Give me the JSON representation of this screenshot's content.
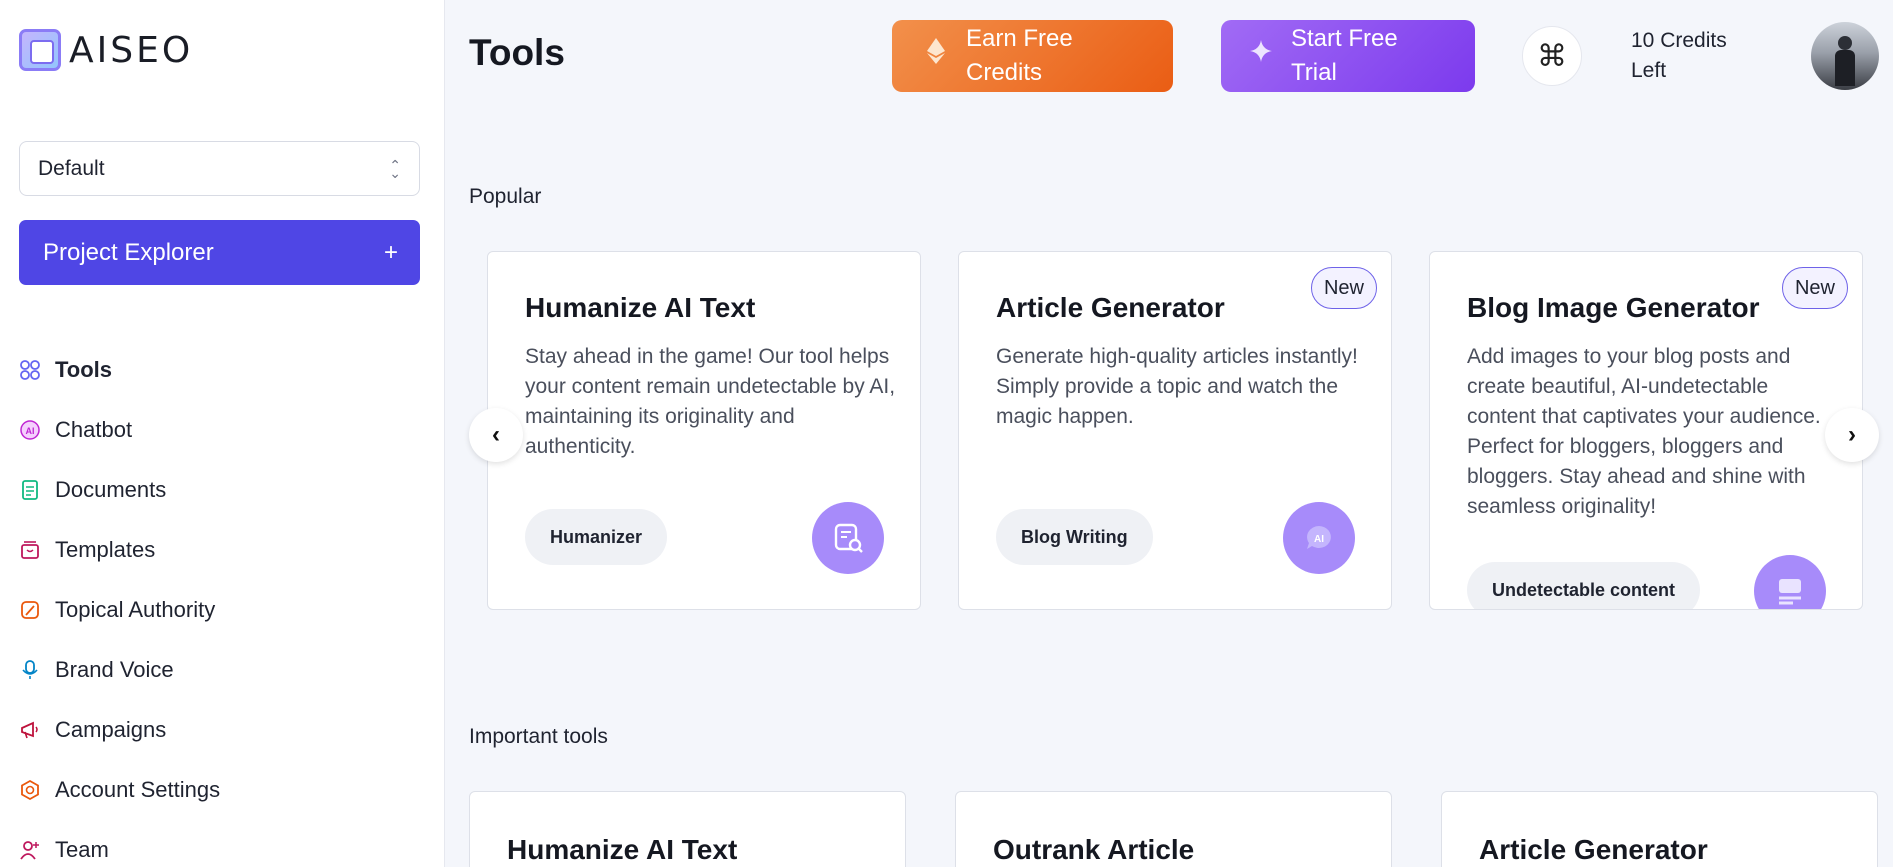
{
  "logo": {
    "text": "AISEO"
  },
  "sidebar": {
    "project_select": {
      "value": "Default"
    },
    "project_explorer": {
      "label": "Project Explorer",
      "plus": "+"
    },
    "items": [
      {
        "label": "Tools",
        "icon": "grid-icon",
        "color": "#6366f1",
        "glyph": "⊞",
        "active": true
      },
      {
        "label": "Chatbot",
        "icon": "ai-chat-icon",
        "color": "#c026d3",
        "glyph": "Ⓐ"
      },
      {
        "label": "Documents",
        "icon": "document-icon",
        "color": "#10b981",
        "glyph": "▤"
      },
      {
        "label": "Templates",
        "icon": "template-icon",
        "color": "#be185d",
        "glyph": "▭"
      },
      {
        "label": "Topical Authority",
        "icon": "feather-icon",
        "color": "#ea580c",
        "glyph": "✎"
      },
      {
        "label": "Brand Voice",
        "icon": "microphone-icon",
        "color": "#0284c7",
        "glyph": "♫"
      },
      {
        "label": "Campaigns",
        "icon": "megaphone-icon",
        "color": "#be123c",
        "glyph": "◀"
      },
      {
        "label": "Account Settings",
        "icon": "gear-icon",
        "color": "#ea580c",
        "glyph": "⚙"
      },
      {
        "label": "Team",
        "icon": "user-add-icon",
        "color": "#be185d",
        "glyph": "♙"
      }
    ]
  },
  "header": {
    "title": "Tools",
    "earn": {
      "line1": "Earn Free",
      "line2": "Credits",
      "icon": "ethereum-icon"
    },
    "trial": {
      "line1": "Start Free",
      "line2": "Trial",
      "icon": "sparkle-icon"
    },
    "command": {
      "icon": "command-icon",
      "glyph": "⌘"
    },
    "credits": {
      "line1": "10 Credits",
      "line2": "Left"
    }
  },
  "popular": {
    "label": "Popular",
    "cards": [
      {
        "title": "Humanize AI Text",
        "desc": "Stay ahead in the game! Our tool helps your content remain undetectable by AI, maintaining its originality and authenticity.",
        "chip": "Humanizer",
        "icon": "document-search-icon",
        "new": ""
      },
      {
        "title": "Article Generator",
        "desc": "Generate high-quality articles instantly! Simply provide a topic and watch the magic happen.",
        "chip": "Blog Writing",
        "icon": "ai-chat-icon",
        "new": "New"
      },
      {
        "title": "Blog Image Generator",
        "desc": "Add images to your blog posts and create beautiful, AI-undetectable content that captivates your audience. Perfect for bloggers, bloggers and bloggers. Stay ahead and shine with seamless originality!",
        "chip": "Undetectable content",
        "icon": "image-card-icon",
        "new": "New"
      }
    ],
    "prev": "‹",
    "next": "›"
  },
  "important": {
    "label": "Important tools",
    "cards": [
      {
        "title": "Humanize AI Text"
      },
      {
        "title": "Outrank Article"
      },
      {
        "title": "Article Generator"
      }
    ]
  }
}
